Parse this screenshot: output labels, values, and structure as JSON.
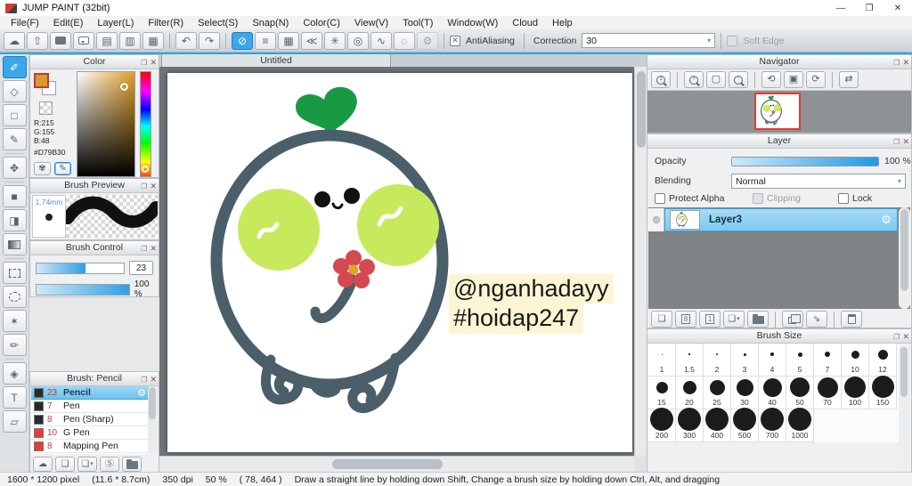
{
  "window": {
    "title": "JUMP PAINT (32bit)",
    "controls": {
      "minimize": "—",
      "restore": "❐",
      "close": "✕"
    }
  },
  "icons": {
    "popout": "❐",
    "close": "✕",
    "gear": "⚙"
  },
  "menu": [
    "File(F)",
    "Edit(E)",
    "Layer(L)",
    "Filter(R)",
    "Select(S)",
    "Snap(N)",
    "Color(C)",
    "View(V)",
    "Tool(T)",
    "Window(W)",
    "Cloud",
    "Help"
  ],
  "toolbar": {
    "file_icons": [
      {
        "name": "cloud-icon",
        "glyph": "☁"
      },
      {
        "name": "upload-icon",
        "glyph": "⇧"
      },
      {
        "name": "chat-icon",
        "type": "bubble"
      },
      {
        "name": "comment-icon",
        "type": "bubble2"
      },
      {
        "name": "document-icon",
        "glyph": "▤"
      },
      {
        "name": "layout-icon",
        "glyph": "▥"
      },
      {
        "name": "material-icon",
        "glyph": "▦"
      }
    ],
    "history_icons": [
      {
        "name": "undo-icon",
        "glyph": "↶"
      },
      {
        "name": "redo-icon",
        "glyph": "↷"
      }
    ],
    "snap_icons": [
      {
        "name": "snap-off-icon",
        "glyph": "⊘",
        "selected": true
      },
      {
        "name": "snap-parallel-icon",
        "glyph": "≡"
      },
      {
        "name": "snap-grid-icon",
        "glyph": "▦"
      },
      {
        "name": "snap-vanishing-point-icon",
        "glyph": "≪"
      },
      {
        "name": "snap-cross-icon",
        "glyph": "✳"
      },
      {
        "name": "snap-concentric-icon",
        "glyph": "◎"
      },
      {
        "name": "snap-curve-icon",
        "glyph": "∿"
      },
      {
        "name": "snap-radial-icon",
        "glyph": "◌"
      },
      {
        "name": "snap-settings-icon",
        "glyph": "⚙",
        "disabled": true
      }
    ],
    "antialiasing_label": "AntiAliasing",
    "antialiasing_checked": "✕",
    "correction_label": "Correction",
    "correction_value": "30",
    "soft_edge_label": "Soft Edge"
  },
  "tools": [
    {
      "name": "brush-tool",
      "glyph": "✐",
      "selected": true
    },
    {
      "name": "eraser-tool",
      "glyph": "◇"
    },
    {
      "name": "shape-brush-tool",
      "glyph": "□"
    },
    {
      "name": "control-point-tool",
      "glyph": "✎"
    },
    {
      "divider": true
    },
    {
      "name": "move-tool",
      "glyph": "✥"
    },
    {
      "divider": true
    },
    {
      "name": "fill-rect-tool",
      "glyph": "■"
    },
    {
      "name": "bucket-tool",
      "glyph": "◨"
    },
    {
      "name": "gradient-tool",
      "type": "gradient"
    },
    {
      "divider": true
    },
    {
      "name": "select-rect-tool",
      "type": "dashedbox"
    },
    {
      "name": "lasso-tool",
      "type": "dashedcircle"
    },
    {
      "name": "magic-wand-tool",
      "glyph": "✶"
    },
    {
      "name": "select-pen-tool",
      "glyph": "✏"
    },
    {
      "divider": true
    },
    {
      "name": "select-eraser-tool",
      "glyph": "◈"
    },
    {
      "name": "text-tool",
      "glyph": "T"
    },
    {
      "name": "shape-select-tool",
      "glyph": "▱"
    }
  ],
  "color_panel": {
    "title": "Color",
    "r_label": "R:215",
    "g_label": "G:155",
    "b_label": "B:48",
    "hex_label": "#D79B30",
    "foreground_color": "#D79B30",
    "palette_buttons": [
      {
        "name": "palette-icon",
        "glyph": "✾"
      },
      {
        "name": "palette-edit-icon",
        "glyph": "✎",
        "active": true
      }
    ]
  },
  "brush_preview": {
    "title": "Brush Preview",
    "size_label": "1.74mm"
  },
  "brush_control": {
    "title": "Brush Control",
    "size_value": "23",
    "opacity_value": "100 %"
  },
  "brush_panel": {
    "title": "Brush: Pencil",
    "brushes": [
      {
        "size": "23",
        "name": "Pencil",
        "swatch": "#2a2a2a",
        "selected": true
      },
      {
        "size": "7",
        "name": "Pen",
        "swatch": "#2a2a2a"
      },
      {
        "size": "8",
        "name": "Pen (Sharp)",
        "swatch": "#2a2a2a"
      },
      {
        "size": "10",
        "name": "G Pen",
        "swatch": "#e63c35"
      },
      {
        "size": "8",
        "name": "Mapping Pen",
        "swatch": "#e63c35"
      }
    ],
    "buttons": [
      {
        "name": "download-brush-button",
        "glyph": "☁"
      },
      {
        "name": "new-brush-button",
        "glyph": "❏"
      },
      {
        "name": "save-brush-button",
        "glyph": "❏",
        "caret": true
      },
      {
        "name": "script-brush-button",
        "glyph": "Ⓢ"
      },
      {
        "name": "brush-folder-button",
        "type": "folder"
      }
    ]
  },
  "canvas": {
    "tab_label": "Untitled",
    "watermark_line1": "@nganhadayy",
    "watermark_line2": "#hoidap247"
  },
  "navigator": {
    "title": "Navigator",
    "icons": [
      {
        "name": "zoom-100-icon",
        "type": "mag",
        "sub": "1"
      },
      {
        "divider": true
      },
      {
        "name": "zoom-in-icon",
        "type": "mag",
        "sub": "+"
      },
      {
        "name": "fit-screen-icon",
        "glyph": "▢"
      },
      {
        "name": "zoom-out-icon",
        "type": "mag",
        "sub": "−"
      },
      {
        "divider": true
      },
      {
        "name": "rotate-ccw-icon",
        "glyph": "⟲"
      },
      {
        "name": "reset-rotation-icon",
        "glyph": "▣"
      },
      {
        "name": "rotate-cw-icon",
        "glyph": "⟳"
      },
      {
        "divider": true
      },
      {
        "name": "flip-icon",
        "glyph": "⇄"
      }
    ]
  },
  "layer_panel": {
    "title": "Layer",
    "opacity_label": "Opacity",
    "opacity_value": "100 %",
    "blending_label": "Blending",
    "blending_value": "Normal",
    "protect_alpha_label": "Protect Alpha",
    "clipping_label": "Clipping",
    "lock_label": "Lock",
    "layers": [
      {
        "name": "Layer3",
        "selected": true
      }
    ],
    "buttons": [
      {
        "name": "add-layer-button",
        "glyph": "❏"
      },
      {
        "name": "add-8bit-layer-button",
        "glyph": "8",
        "boxed": true
      },
      {
        "name": "add-1bit-layer-button",
        "glyph": "1",
        "boxed": true
      },
      {
        "name": "add-layer-menu-button",
        "glyph": "❏",
        "caret": true
      },
      {
        "name": "layer-folder-button",
        "type": "folder"
      },
      {
        "divider": true
      },
      {
        "name": "duplicate-layer-button",
        "type": "copy"
      },
      {
        "name": "merge-layer-button",
        "glyph": "⇘"
      },
      {
        "divider": true
      },
      {
        "name": "delete-layer-button",
        "type": "trash"
      }
    ]
  },
  "brush_size_panel": {
    "title": "Brush Size",
    "sizes": [
      {
        "label": "1",
        "dot": 1
      },
      {
        "label": "1.5",
        "dot": 1.5
      },
      {
        "label": "2",
        "dot": 2
      },
      {
        "label": "3",
        "dot": 3
      },
      {
        "label": "4",
        "dot": 4
      },
      {
        "label": "5",
        "dot": 5
      },
      {
        "label": "7",
        "dot": 6.5
      },
      {
        "label": "10",
        "dot": 9
      },
      {
        "label": "12",
        "dot": 11
      },
      {
        "label": "15",
        "dot": 13
      },
      {
        "label": "20",
        "dot": 15
      },
      {
        "label": "25",
        "dot": 17
      },
      {
        "label": "30",
        "dot": 19
      },
      {
        "label": "40",
        "dot": 21
      },
      {
        "label": "50",
        "dot": 22
      },
      {
        "label": "70",
        "dot": 23
      },
      {
        "label": "100",
        "dot": 24
      },
      {
        "label": "150",
        "dot": 25
      },
      {
        "label": "200",
        "dot": 26
      },
      {
        "label": "300",
        "dot": 26
      },
      {
        "label": "400",
        "dot": 26
      },
      {
        "label": "500",
        "dot": 26
      },
      {
        "label": "700",
        "dot": 26
      },
      {
        "label": "1000",
        "dot": 26
      }
    ]
  },
  "statusbar": {
    "size_px": "1600 * 1200 pixel",
    "size_cm": "(11.6 * 8.7cm)",
    "dpi": "350 dpi",
    "zoom": "50 %",
    "cursor": "( 78, 464 )",
    "hint": "Draw a straight line by holding down Shift, Change a brush size by holding down Ctrl, Alt, and dragging"
  },
  "colors": {
    "accent": "#2ba7e3",
    "selection": "#7cc8f0",
    "foreground": "#D79B30"
  }
}
